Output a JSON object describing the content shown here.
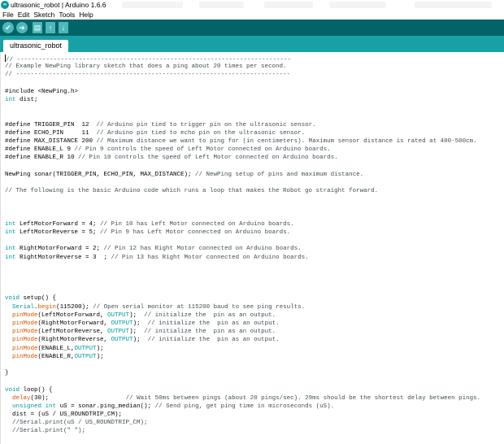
{
  "window": {
    "title": "ultrasonic_robot | Arduino 1.6.6",
    "icon": "arduino-logo-icon"
  },
  "menu": [
    "File",
    "Edit",
    "Sketch",
    "Tools",
    "Help"
  ],
  "toolbar": {
    "buttons": [
      {
        "name": "verify",
        "icon": "checkmark-icon",
        "glyph": "✔"
      },
      {
        "name": "upload",
        "icon": "arrow-right-icon",
        "glyph": "➜"
      },
      {
        "name": "new",
        "icon": "new-file-icon",
        "glyph": "▤"
      },
      {
        "name": "open",
        "icon": "arrow-up-icon",
        "glyph": "↑"
      },
      {
        "name": "save",
        "icon": "arrow-down-icon",
        "glyph": "↓"
      }
    ]
  },
  "tab": {
    "label": "ultrasonic_robot"
  },
  "colors": {
    "toolbar_bg": "#006468",
    "tabstrip_bg": "#17a1a5",
    "button_bg": "#4db7bb",
    "keyword": "#00979c",
    "function": "#d35400",
    "comment": "#434f54"
  },
  "code_lines": [
    "// ---------------------------------------------------------------------------",
    "// Example NewPing library sketch that does a ping about 20 times per second.",
    "// ---------------------------------------------------------------------------",
    "",
    "#include <NewPing.h>",
    "int dist;",
    "",
    "",
    "#define TRIGGER_PIN  12  // Arduino pin tied to trigger pin on the ultrasonic sensor.",
    "#define ECHO_PIN     11  // Arduino pin tied to echo pin on the ultrasonic sensor.",
    "#define MAX_DISTANCE 200 // Maximum distance we want to ping for (in centimeters). Maximum sensor distance is rated at 400-500cm.",
    "#define ENABLE_L 9 // Pin 9 controls the speed of Left Motor connected on Arduino boards.",
    "#define ENABLE_R 10 // Pin 10 controls the speed of Left Motor connected on Arduino boards.",
    "",
    "NewPing sonar(TRIGGER_PIN, ECHO_PIN, MAX_DISTANCE); // NewPing setup of pins and maximum distance.",
    "",
    "// The following is the basic Arduino code which runs a loop that makes the Robot go straight forward.",
    "",
    "",
    "",
    "int LeftMotorForward = 4; // Pin 10 has Left Motor connected on Arduino boards.",
    "int LeftMotorReverse = 5; // Pin 9 has Left Motor connected on Arduino boards.",
    "",
    "int RightMotorForward = 2; // Pin 12 has Right Motor connected on Arduino boards.",
    "int RightMotorReverse = 3  ; // Pin 13 has Right Motor connected on Arduino boards.",
    "",
    "",
    "",
    "",
    "void setup() {",
    "  Serial.begin(115200); // Open serial monitor at 115200 baud to see ping results.",
    "  pinMode(LeftMotorForward, OUTPUT);  // initialize the  pin as an output.",
    "  pinMode(RightMotorForward, OUTPUT);  // initialize the  pin as an output.",
    "  pinMode(LeftMotorReverse, OUTPUT);  // initialize the  pin as an output.",
    "  pinMode(RightMotorReverse, OUTPUT);  // initialize the  pin as an output.",
    "  pinMode(ENABLE_L,OUTPUT);",
    "  pinMode(ENABLE_R,OUTPUT);",
    "",
    "}",
    "",
    "void loop() {",
    "  delay(30);                     // Wait 50ms between pings (about 20 pings/sec). 29ms should be the shortest delay between pings.",
    "  unsigned int uS = sonar.ping_median(); // Send ping, get ping time in microseconds (uS).",
    "  dist = (uS / US_ROUNDTRIP_CM);",
    "  //Serial.print(uS / US_ROUNDTRIP_CM);",
    "  //Serial.print(\" \");"
  ]
}
